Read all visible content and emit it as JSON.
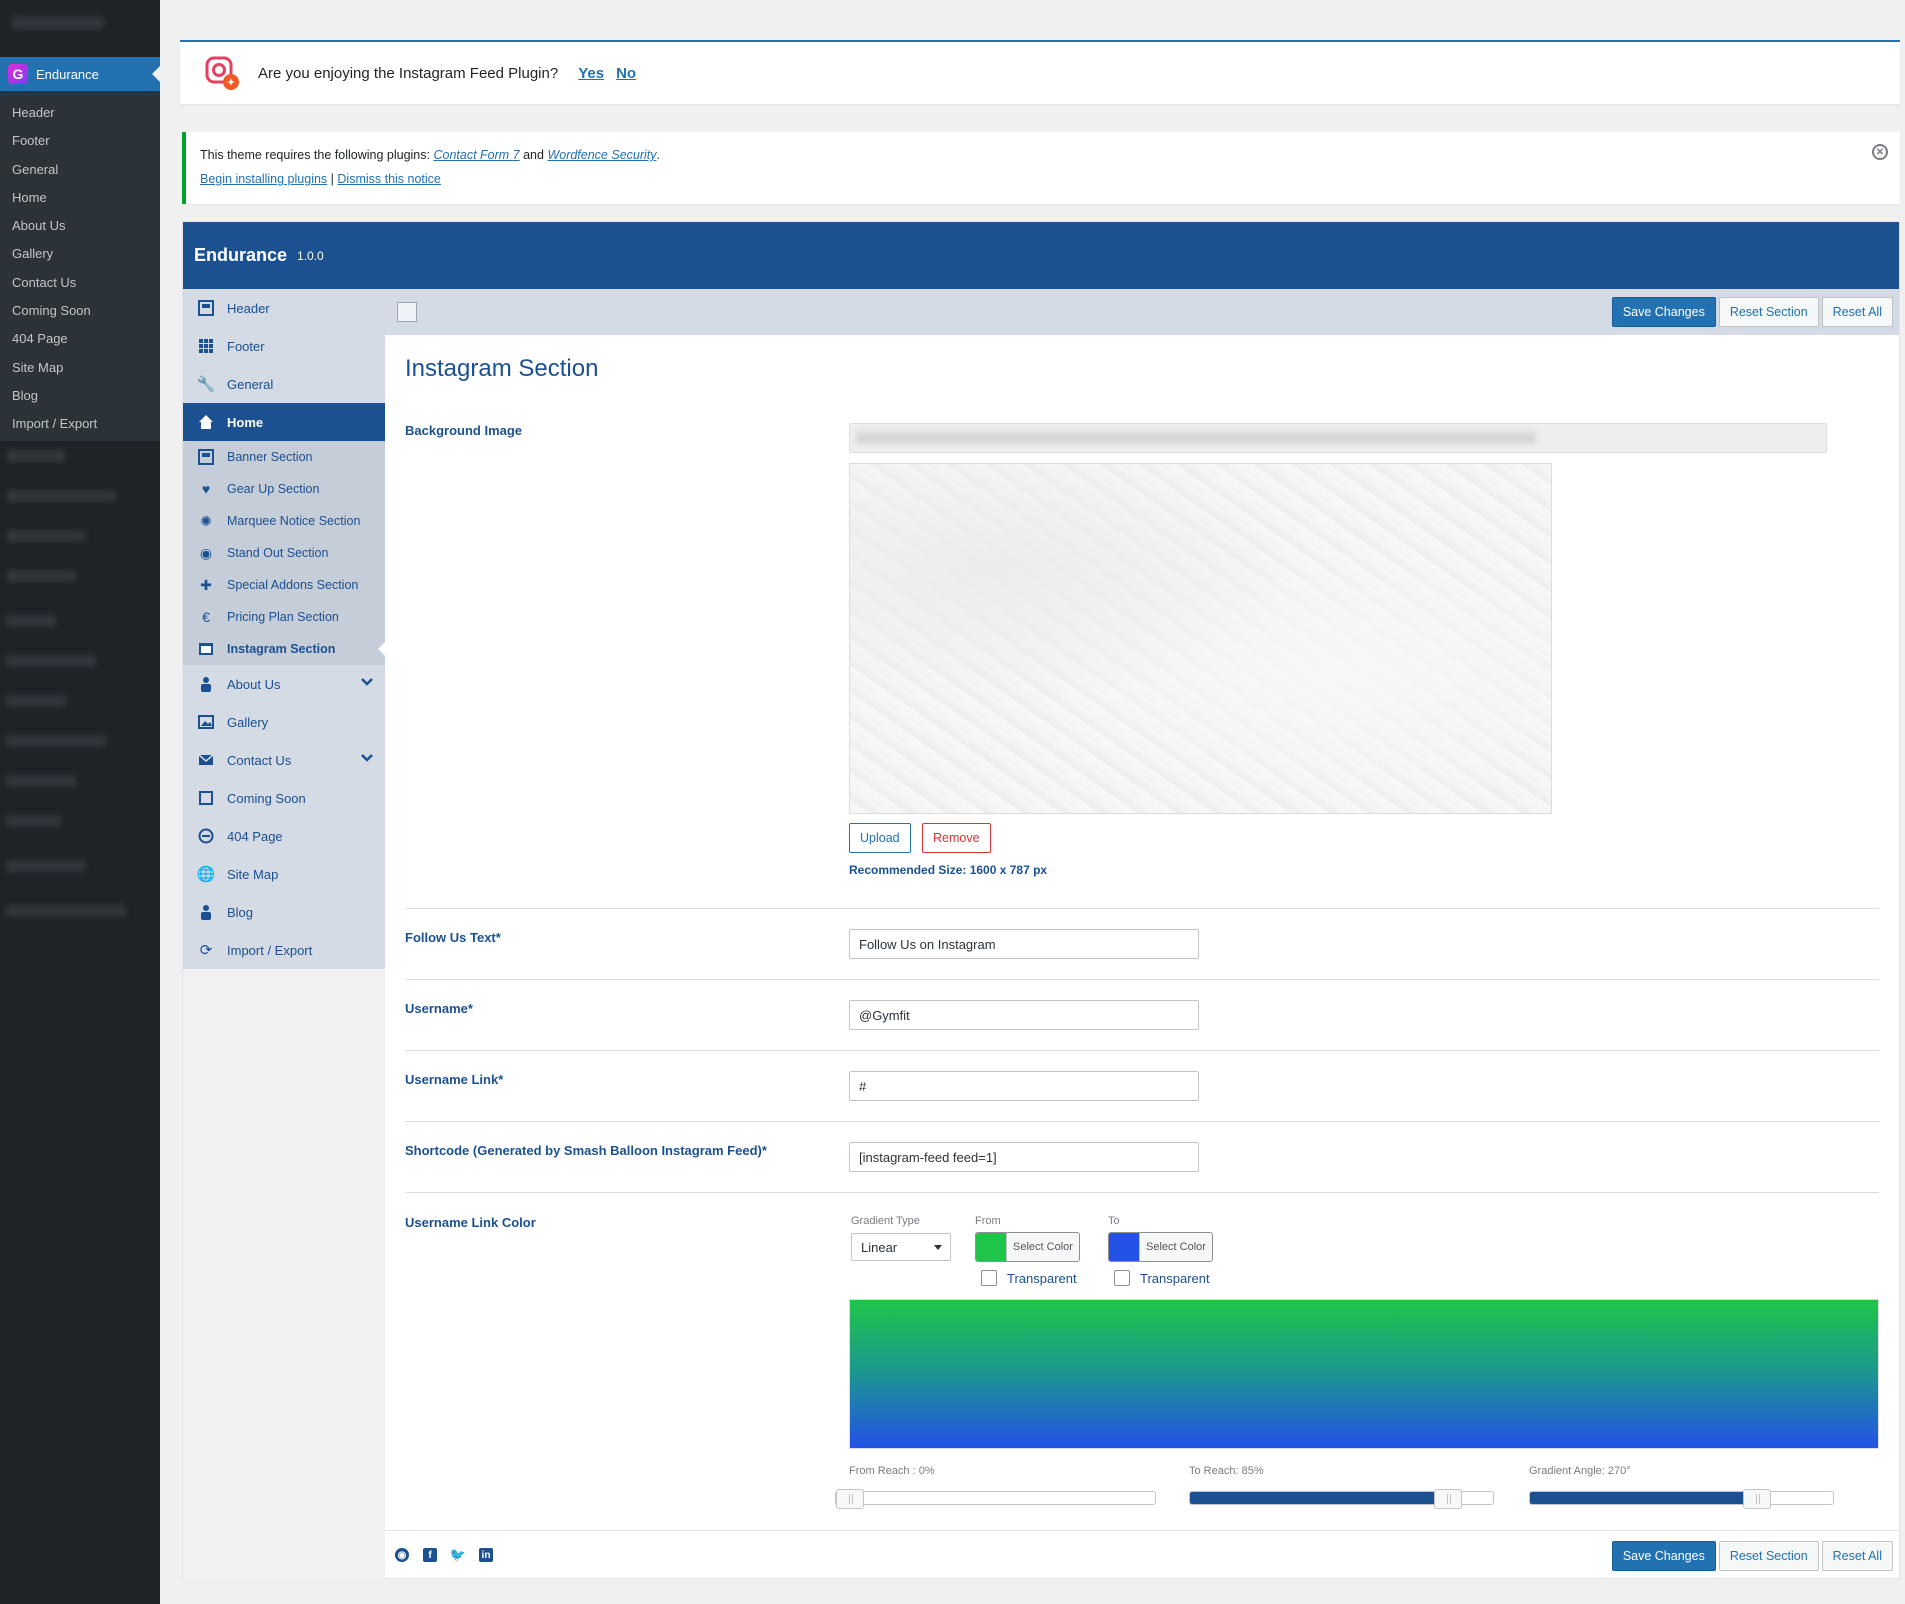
{
  "wp_menu": {
    "active_label": "Endurance",
    "items": [
      "Header",
      "Footer",
      "General",
      "Home",
      "About Us",
      "Gallery",
      "Contact Us",
      "Coming Soon",
      "404 Page",
      "Site Map",
      "Blog",
      "Import / Export"
    ]
  },
  "ig_notice": {
    "question": "Are you enjoying the Instagram Feed Plugin?",
    "yes": "Yes",
    "no": "No"
  },
  "plugin_notice": {
    "prefix": "This theme requires the following plugins:",
    "plugin1": "Contact Form 7",
    "and": "and",
    "plugin2": "Wordfence Security",
    "dot": ".",
    "begin": "Begin installing plugins",
    "sep": "|",
    "dismiss": "Dismiss this notice"
  },
  "panel": {
    "title": "Endurance",
    "version": "1.0.0"
  },
  "nav": {
    "header": "Header",
    "footer": "Footer",
    "general": "General",
    "home": "Home",
    "home_sub": [
      "Banner Section",
      "Gear Up Section",
      "Marquee Notice Section",
      "Stand Out Section",
      "Special Addons Section",
      "Pricing Plan Section",
      "Instagram Section"
    ],
    "about": "About Us",
    "gallery": "Gallery",
    "contact": "Contact Us",
    "coming_soon": "Coming Soon",
    "page404": "404 Page",
    "sitemap": "Site Map",
    "blog": "Blog",
    "import_export": "Import / Export"
  },
  "buttons": {
    "save": "Save Changes",
    "reset_section": "Reset Section",
    "reset_all": "Reset All"
  },
  "section": {
    "title": "Instagram Section",
    "bg_label": "Background Image",
    "upload": "Upload",
    "remove": "Remove",
    "recommended": "Recommended Size: 1600 x 787 px",
    "follow_label": "Follow Us Text*",
    "follow_value": "Follow Us on Instagram",
    "username_label": "Username*",
    "username_value": "@Gymfit",
    "link_label": "Username Link*",
    "link_value": "#",
    "shortcode_label": "Shortcode (Generated by Smash Balloon Instagram Feed)*",
    "shortcode_value": "[instagram-feed feed=1]",
    "color_label": "Username Link Color"
  },
  "gradient": {
    "type_label": "Gradient Type",
    "type_value": "Linear",
    "from_label": "From",
    "to_label": "To",
    "from_color": "#1ec548",
    "to_color": "#2451e6",
    "select_color": "Select Color",
    "transparent": "Transparent",
    "from_reach_label": "From Reach :",
    "from_reach_value": "0%",
    "to_reach_label": "To Reach:",
    "to_reach_value": "85%",
    "angle_label": "Gradient Angle:",
    "angle_value": "270°",
    "from_reach_fraction": 0,
    "to_reach_fraction": 0.85,
    "angle_fraction": 0.75
  },
  "colors": {
    "brand": "#1b5091",
    "wp_blue": "#2271b1",
    "danger": "#d63638"
  }
}
